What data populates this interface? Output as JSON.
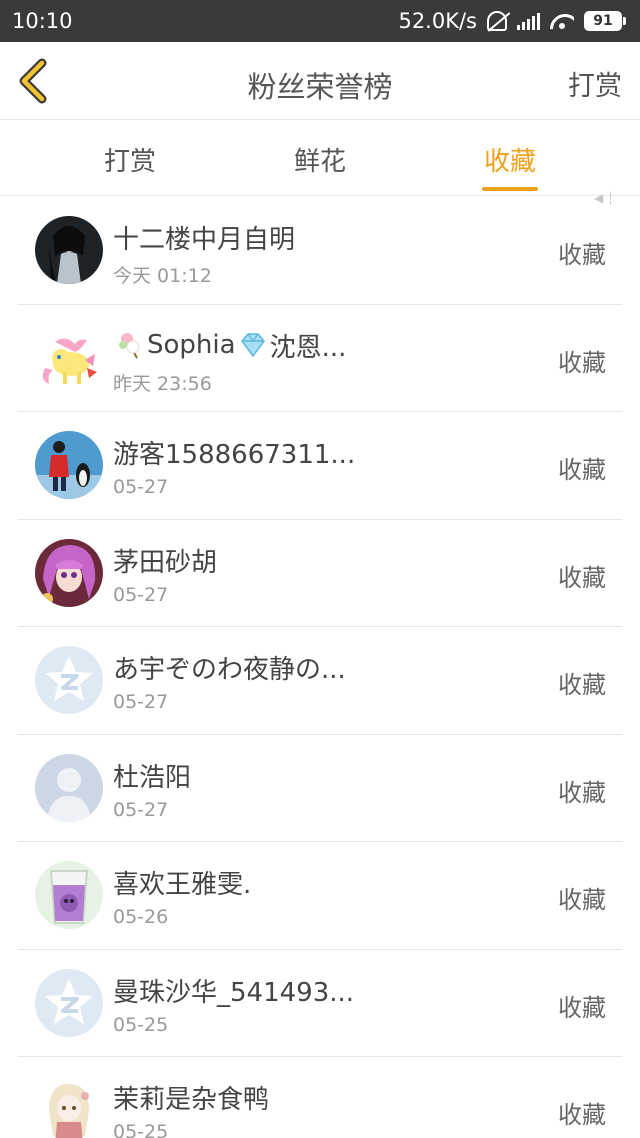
{
  "status_bar": {
    "time": "10:10",
    "network_speed": "52.0K/s",
    "battery": "91"
  },
  "header": {
    "title": "粉丝荣誉榜",
    "action_label": "打赏"
  },
  "tabs": [
    {
      "label": "打赏",
      "active": false
    },
    {
      "label": "鲜花",
      "active": false
    },
    {
      "label": "收藏",
      "active": true
    }
  ],
  "colors": {
    "accent": "#f0a11b",
    "status_bar": "#3a3a3a"
  },
  "list": [
    {
      "name": "十二楼中月自明",
      "time": "今天 01:12",
      "action": "收藏",
      "avatar": "dark-figure-avatar"
    },
    {
      "name": "Sophia",
      "name_prefix_icon": "candy-emoji-icon",
      "name_middle_icon": "diamond-emoji-icon",
      "name_suffix": "沈恩...",
      "time": "昨天 23:56",
      "action": "收藏",
      "avatar": "pony-avatar"
    },
    {
      "name": "游客1588667311...",
      "time": "05-27",
      "action": "收藏",
      "avatar": "red-figure-avatar"
    },
    {
      "name": "茅田砂胡",
      "time": "05-27",
      "action": "收藏",
      "avatar": "anime-girl-avatar"
    },
    {
      "name": "あ宇ぞのわ夜静の...",
      "time": "05-27",
      "action": "收藏",
      "avatar": "default-star-avatar"
    },
    {
      "name": "杜浩阳",
      "time": "05-27",
      "action": "收藏",
      "avatar": "default-person-avatar"
    },
    {
      "name": "喜欢王雅雯.",
      "time": "05-26",
      "action": "收藏",
      "avatar": "purple-cup-avatar"
    },
    {
      "name": "曼珠沙华_541493...",
      "time": "05-25",
      "action": "收藏",
      "avatar": "default-star-avatar"
    },
    {
      "name": "茉莉是杂食鸭",
      "time": "05-25",
      "action": "收藏",
      "avatar": "chibi-avatar"
    }
  ]
}
